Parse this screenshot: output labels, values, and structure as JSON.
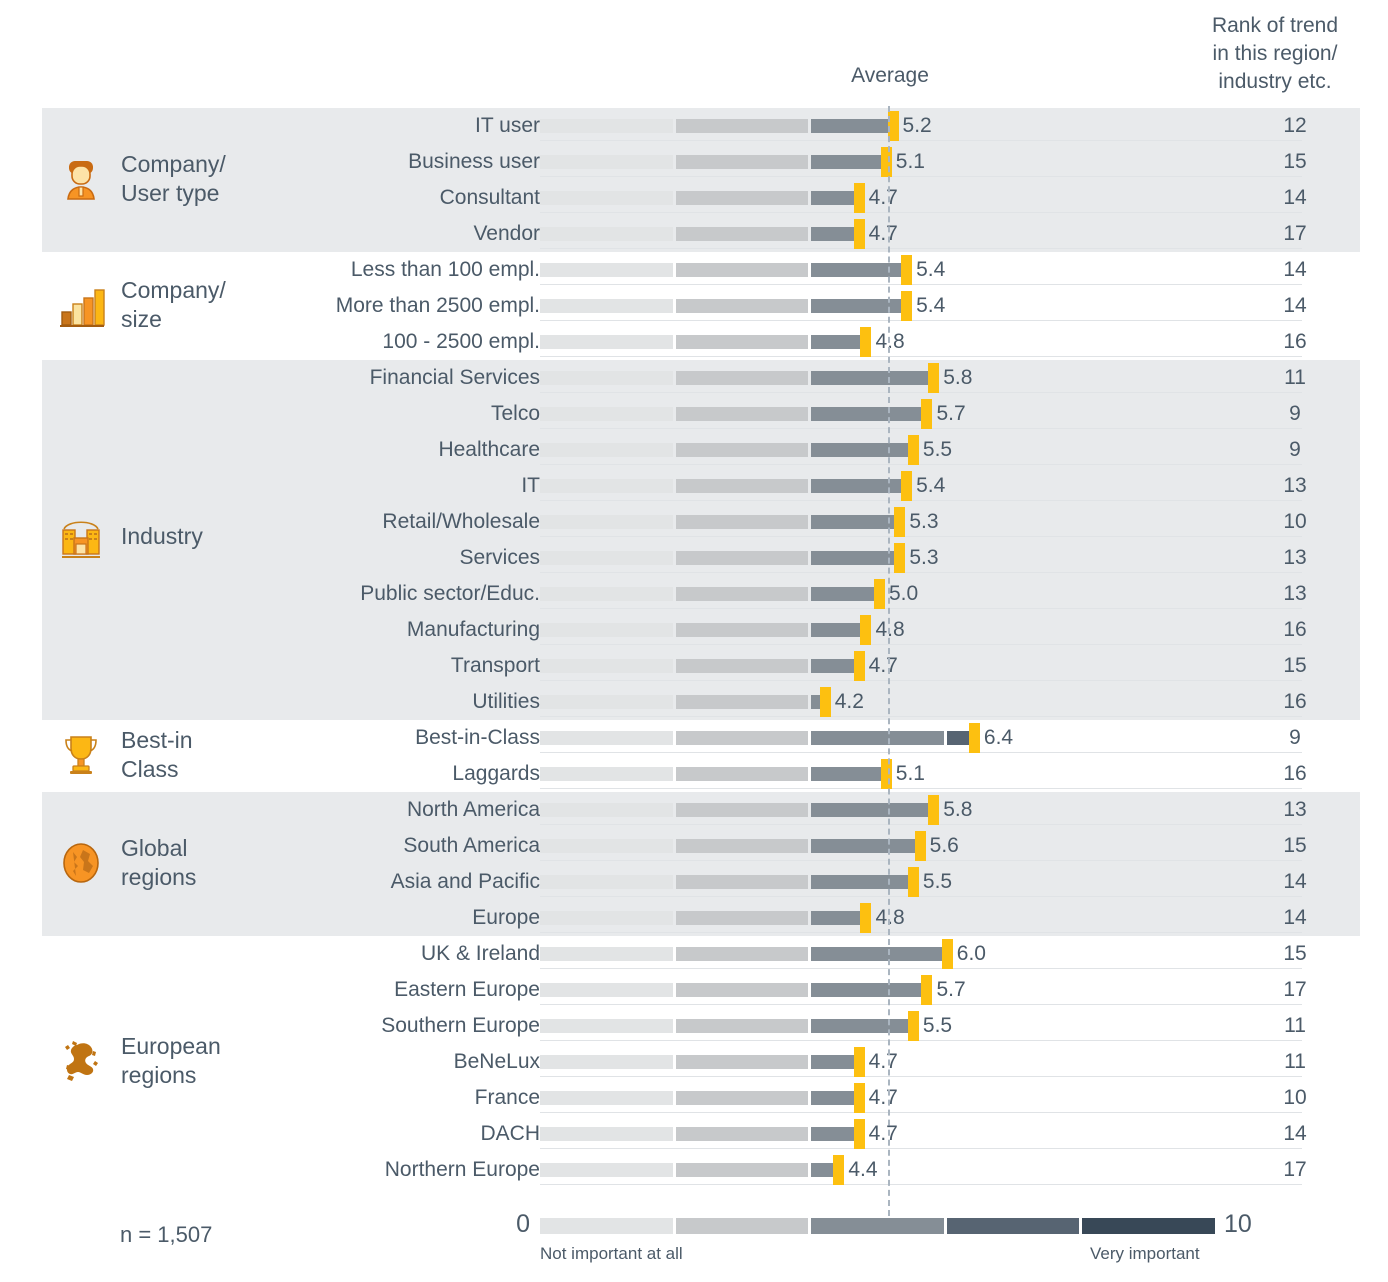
{
  "header": {
    "rank_title": "Rank of trend in this region/ industry etc.",
    "rank_title_l1": "Rank of trend",
    "rank_title_l2": "in this region/",
    "rank_title_l3": "industry etc.",
    "average_label": "Average"
  },
  "footer": {
    "scale_min": "0",
    "scale_max": "10",
    "caption_left": "Not important at all",
    "caption_right": "Very important",
    "sample_size": "n = 1,507"
  },
  "colors": {
    "band_bg": "#e8eaec",
    "marker": "#fdc010",
    "text": "#4b5a68",
    "avg_line": "#aab5c0",
    "seg1": "#e2e4e5",
    "seg2": "#c7c9cb",
    "seg3": "#858e96",
    "seg4": "#576472",
    "seg5": "#384857"
  },
  "chart_data": {
    "type": "bar",
    "title": "",
    "xlabel": "",
    "ylabel": "",
    "xlim": [
      0,
      10
    ],
    "grid": false,
    "legend_position": "bottom",
    "average_line_value": 5.13,
    "scale_labels": {
      "min": "Not important at all",
      "max": "Very important"
    },
    "series": [
      {
        "name": "Average importance (0-10)",
        "values": [
          5.2,
          5.1,
          4.7,
          4.7,
          5.4,
          5.4,
          4.8,
          5.8,
          5.7,
          5.5,
          5.4,
          5.3,
          5.3,
          5.0,
          4.8,
          4.7,
          4.2,
          6.4,
          5.1,
          5.8,
          5.6,
          5.5,
          4.8,
          6.0,
          5.7,
          5.5,
          4.7,
          4.7,
          4.7,
          4.4
        ]
      },
      {
        "name": "Rank of trend in this region/industry",
        "values": [
          12,
          15,
          14,
          17,
          14,
          14,
          16,
          11,
          9,
          9,
          13,
          10,
          13,
          13,
          16,
          15,
          16,
          9,
          16,
          13,
          15,
          14,
          14,
          15,
          17,
          11,
          11,
          10,
          14,
          17
        ]
      }
    ],
    "categories": [
      "IT user",
      "Business user",
      "Consultant",
      "Vendor",
      "Less than 100 empl.",
      "More than 2500 empl.",
      "100 - 2500 empl.",
      "Financial Services",
      "Telco",
      "Healthcare",
      "IT",
      "Retail/Wholesale",
      "Services",
      "Public sector/Educ.",
      "Manufacturing",
      "Transport",
      "Utilities",
      "Best-in-Class",
      "Laggards",
      "North America",
      "South America",
      "Asia and Pacific",
      "Europe",
      "UK & Ireland",
      "Eastern Europe",
      "Southern Europe",
      "BeNeLux",
      "France",
      "DACH",
      "Northern Europe"
    ]
  },
  "groups": [
    {
      "id": "company-user-type",
      "title_l1": "Company/",
      "title_l2": "User type",
      "icon": "person-icon",
      "shaded": true,
      "rows": [
        {
          "label": "IT user",
          "value": 5.2,
          "value_text": "5.2",
          "rank": "12"
        },
        {
          "label": "Business user",
          "value": 5.1,
          "value_text": "5.1",
          "rank": "15"
        },
        {
          "label": "Consultant",
          "value": 4.7,
          "value_text": "4.7",
          "rank": "14"
        },
        {
          "label": "Vendor",
          "value": 4.7,
          "value_text": "4.7",
          "rank": "17"
        }
      ]
    },
    {
      "id": "company-size",
      "title_l1": "Company/",
      "title_l2": "size",
      "icon": "bar-chart-icon",
      "shaded": false,
      "rows": [
        {
          "label": "Less than 100 empl.",
          "value": 5.4,
          "value_text": "5.4",
          "rank": "14"
        },
        {
          "label": "More than 2500 empl.",
          "value": 5.4,
          "value_text": "5.4",
          "rank": "14"
        },
        {
          "label": "100 - 2500 empl.",
          "value": 4.8,
          "value_text": "4.8",
          "rank": "16"
        }
      ]
    },
    {
      "id": "industry",
      "title_l1": "Industry",
      "title_l2": "",
      "icon": "building-icon",
      "shaded": true,
      "rows": [
        {
          "label": "Financial Services",
          "value": 5.8,
          "value_text": "5.8",
          "rank": "11"
        },
        {
          "label": "Telco",
          "value": 5.7,
          "value_text": "5.7",
          "rank": "9"
        },
        {
          "label": "Healthcare",
          "value": 5.5,
          "value_text": "5.5",
          "rank": "9"
        },
        {
          "label": "IT",
          "value": 5.4,
          "value_text": "5.4",
          "rank": "13"
        },
        {
          "label": "Retail/Wholesale",
          "value": 5.3,
          "value_text": "5.3",
          "rank": "10"
        },
        {
          "label": "Services",
          "value": 5.3,
          "value_text": "5.3",
          "rank": "13"
        },
        {
          "label": "Public sector/Educ.",
          "value": 5.0,
          "value_text": "5.0",
          "rank": "13"
        },
        {
          "label": "Manufacturing",
          "value": 4.8,
          "value_text": "4.8",
          "rank": "16"
        },
        {
          "label": "Transport",
          "value": 4.7,
          "value_text": "4.7",
          "rank": "15"
        },
        {
          "label": "Utilities",
          "value": 4.2,
          "value_text": "4.2",
          "rank": "16"
        }
      ]
    },
    {
      "id": "best-in-class",
      "title_l1": "Best-in",
      "title_l2": "Class",
      "icon": "trophy-icon",
      "shaded": false,
      "rows": [
        {
          "label": "Best-in-Class",
          "value": 6.4,
          "value_text": "6.4",
          "rank": "9"
        },
        {
          "label": "Laggards",
          "value": 5.1,
          "value_text": "5.1",
          "rank": "16"
        }
      ]
    },
    {
      "id": "global-regions",
      "title_l1": "Global",
      "title_l2": "regions",
      "icon": "globe-icon",
      "shaded": true,
      "rows": [
        {
          "label": "North America",
          "value": 5.8,
          "value_text": "5.8",
          "rank": "13"
        },
        {
          "label": "South America",
          "value": 5.6,
          "value_text": "5.6",
          "rank": "15"
        },
        {
          "label": "Asia and Pacific",
          "value": 5.5,
          "value_text": "5.5",
          "rank": "14"
        },
        {
          "label": "Europe",
          "value": 4.8,
          "value_text": "4.8",
          "rank": "14"
        }
      ]
    },
    {
      "id": "european-regions",
      "title_l1": "European",
      "title_l2": "regions",
      "icon": "europe-map-icon",
      "shaded": false,
      "rows": [
        {
          "label": "UK & Ireland",
          "value": 6.0,
          "value_text": "6.0",
          "rank": "15"
        },
        {
          "label": "Eastern Europe",
          "value": 5.7,
          "value_text": "5.7",
          "rank": "17"
        },
        {
          "label": "Southern Europe",
          "value": 5.5,
          "value_text": "5.5",
          "rank": "11"
        },
        {
          "label": "BeNeLux",
          "value": 4.7,
          "value_text": "4.7",
          "rank": "11"
        },
        {
          "label": "France",
          "value": 4.7,
          "value_text": "4.7",
          "rank": "10"
        },
        {
          "label": "DACH",
          "value": 4.7,
          "value_text": "4.7",
          "rank": "14"
        },
        {
          "label": "Northern Europe",
          "value": 4.4,
          "value_text": "4.4",
          "rank": "17"
        }
      ]
    }
  ]
}
